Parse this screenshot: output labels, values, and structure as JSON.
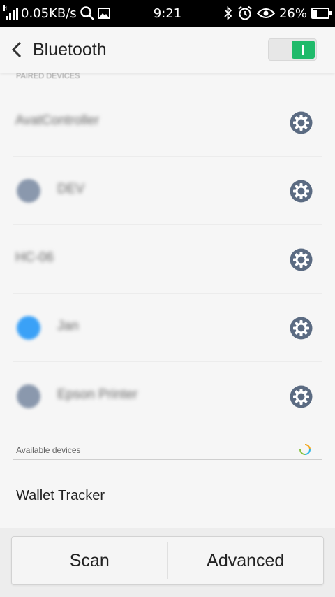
{
  "status_bar": {
    "network_speed": "0.05KB/s",
    "time": "9:21",
    "battery": "26%",
    "battery_level": 0.26,
    "icons": [
      "signal-icon",
      "search-icon",
      "image-icon",
      "bluetooth-icon",
      "alarm-icon",
      "eye-icon",
      "battery-icon"
    ]
  },
  "header": {
    "title": "Bluetooth",
    "bluetooth_enabled": true,
    "toggle_color": "#1fba6a"
  },
  "paired": {
    "label": "PAIRED DEVICES",
    "devices": [
      {
        "name": "AvatController",
        "has_icon": false
      },
      {
        "name": "DEV",
        "has_icon": true,
        "icon_color": "#8a98ad"
      },
      {
        "name": "HC-06",
        "has_icon": false
      },
      {
        "name": "Jan",
        "has_icon": true,
        "icon_color": "#3aa1f7"
      },
      {
        "name": "Epson Printer",
        "has_icon": true,
        "icon_color": "#8a98ad"
      }
    ]
  },
  "available": {
    "label": "Available devices",
    "devices": [
      {
        "name": "Wallet Tracker"
      }
    ]
  },
  "bottom": {
    "scan_label": "Scan",
    "advanced_label": "Advanced"
  }
}
